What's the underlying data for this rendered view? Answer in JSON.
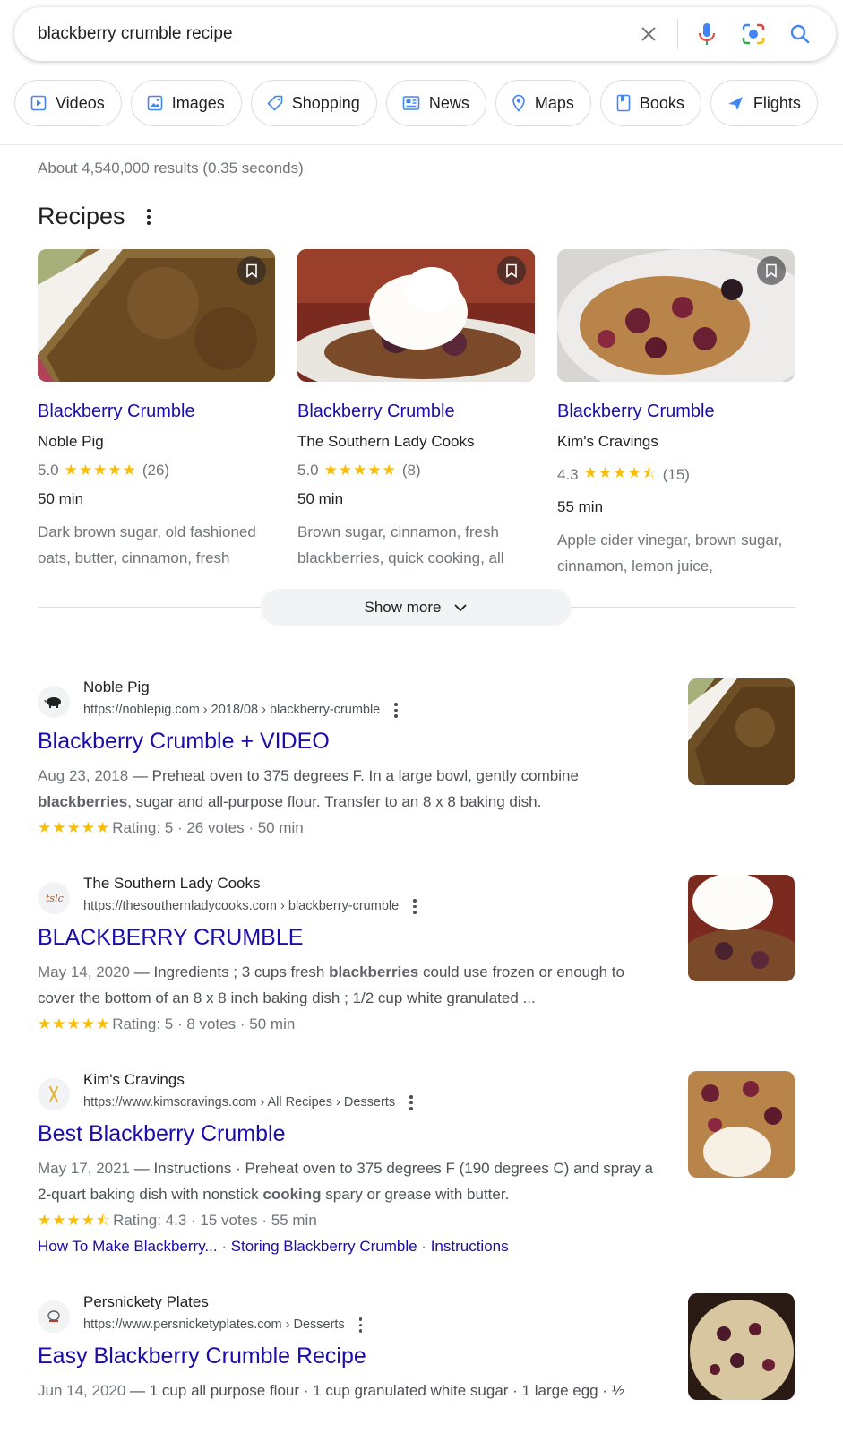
{
  "search": {
    "query": "blackberry crumble recipe"
  },
  "chips": [
    {
      "label": "Videos",
      "icon": "video-icon"
    },
    {
      "label": "Images",
      "icon": "image-icon"
    },
    {
      "label": "Shopping",
      "icon": "tag-icon"
    },
    {
      "label": "News",
      "icon": "news-icon"
    },
    {
      "label": "Maps",
      "icon": "pin-icon"
    },
    {
      "label": "Books",
      "icon": "book-icon"
    },
    {
      "label": "Flights",
      "icon": "plane-icon"
    }
  ],
  "stats": "About 4,540,000 results (0.35 seconds)",
  "recipes": {
    "heading": "Recipes",
    "cards": [
      {
        "title": "Blackberry Crumble",
        "source": "Noble Pig",
        "rating": "5.0",
        "stars": "★★★★★",
        "count": "(26)",
        "time": "50 min",
        "ingredients": "Dark brown sugar, old fashioned oats, butter, cinnamon, fresh"
      },
      {
        "title": "Blackberry Crumble",
        "source": "The Southern Lady Cooks",
        "rating": "5.0",
        "stars": "★★★★★",
        "count": "(8)",
        "time": "50 min",
        "ingredients": "Brown sugar, cinnamon, fresh blackberries, quick cooking, all"
      },
      {
        "title": "Blackberry Crumble",
        "source": "Kim's Cravings",
        "rating": "4.3",
        "stars": "★★★★⯪",
        "count": "(15)",
        "time": "55 min",
        "ingredients": "Apple cider vinegar, brown sugar, cinnamon, lemon juice,"
      }
    ],
    "show_more": "Show more"
  },
  "results": [
    {
      "site": "Noble Pig",
      "url": "https://noblepig.com › 2018/08 › blackberry-crumble",
      "title": "Blackberry Crumble + VIDEO",
      "date": "Aug 23, 2018",
      "snippet_a": " — Preheat oven to 375 degrees F. In a large bowl, gently combine ",
      "snippet_bold": "blackberries",
      "snippet_b": ", sugar and all-purpose flour. Transfer to an 8 x 8 baking dish.",
      "stars": "★★★★★",
      "meta": "Rating: 5 · 26 votes · 50 min"
    },
    {
      "site": "The Southern Lady Cooks",
      "url": "https://thesouthernladycooks.com › blackberry-crumble",
      "title": "BLACKBERRY CRUMBLE",
      "date": "May 14, 2020",
      "snippet_a": " — Ingredients ; 3 cups fresh ",
      "snippet_bold": "blackberries",
      "snippet_b": " could use frozen or enough to cover the bottom of an 8 x 8 inch baking dish ; 1/2 cup white granulated ...",
      "stars": "★★★★★",
      "meta": "Rating: 5 · 8 votes · 50 min"
    },
    {
      "site": "Kim's Cravings",
      "url": "https://www.kimscravings.com › All Recipes › Desserts",
      "title": "Best Blackberry Crumble",
      "date": "May 17, 2021",
      "snippet_a": " — Instructions · Preheat oven to 375 degrees F (190 degrees C) and spray a 2-quart baking dish with nonstick ",
      "snippet_bold": "cooking",
      "snippet_b": " spary or grease with butter.",
      "stars": "★★★★⯪",
      "meta": "Rating: 4.3 · 15 votes · 55 min",
      "sitelinks": [
        "How To Make Blackberry...",
        "Storing Blackberry Crumble",
        "Instructions"
      ]
    },
    {
      "site": "Persnickety Plates",
      "url": "https://www.persnicketyplates.com › Desserts",
      "title": "Easy Blackberry Crumble Recipe",
      "date": "Jun 14, 2020",
      "snippet_a": " — 1 cup all purpose flour · 1 cup granulated white sugar · 1 large egg · ½",
      "snippet_bold": "",
      "snippet_b": ""
    }
  ],
  "colors": {
    "link": "#1a0dab",
    "star": "#fbbc04",
    "muted": "#70757a"
  }
}
